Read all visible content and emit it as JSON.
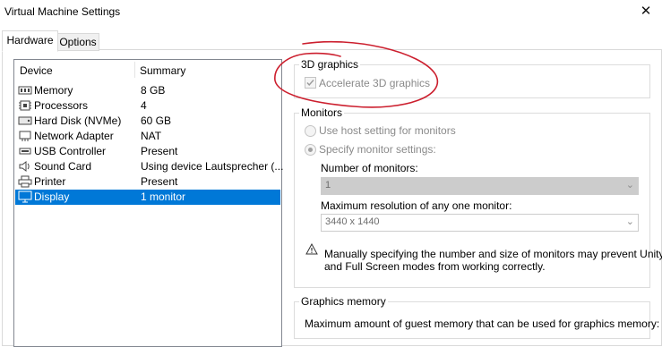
{
  "window": {
    "title": "Virtual Machine Settings",
    "close_glyph": "✕"
  },
  "tabs": [
    {
      "label": "Hardware",
      "active": true
    },
    {
      "label": "Options",
      "active": false
    }
  ],
  "device_list": {
    "columns": {
      "device": "Device",
      "summary": "Summary"
    },
    "rows": [
      {
        "icon": "memory-icon",
        "name": "Memory",
        "summary": "8 GB"
      },
      {
        "icon": "processor-icon",
        "name": "Processors",
        "summary": "4"
      },
      {
        "icon": "hard-disk-icon",
        "name": "Hard Disk (NVMe)",
        "summary": "60 GB"
      },
      {
        "icon": "network-adapter-icon",
        "name": "Network Adapter",
        "summary": "NAT"
      },
      {
        "icon": "usb-controller-icon",
        "name": "USB Controller",
        "summary": "Present"
      },
      {
        "icon": "sound-card-icon",
        "name": "Sound Card",
        "summary": "Using device Lautsprecher (..."
      },
      {
        "icon": "printer-icon",
        "name": "Printer",
        "summary": "Present"
      },
      {
        "icon": "display-icon",
        "name": "Display",
        "summary": "1 monitor",
        "selected": true
      }
    ]
  },
  "graphics_3d": {
    "label": "3D graphics",
    "accelerate_label": "Accelerate 3D graphics",
    "accelerate_checked": true
  },
  "monitors": {
    "label": "Monitors",
    "use_host_label": "Use host setting for monitors",
    "specify_label": "Specify monitor settings:",
    "specify_selected": true,
    "number_label": "Number of monitors:",
    "number_value": "1",
    "resolution_label": "Maximum resolution of any one monitor:",
    "resolution_value": "3440 x 1440",
    "warning_line1": "Manually specifying the number and size of monitors may prevent Unity",
    "warning_line2": "and Full Screen modes from working correctly."
  },
  "graphics_memory": {
    "label": "Graphics memory",
    "description": "Maximum amount of guest memory that can be used for graphics memory:"
  },
  "colors": {
    "selection": "#0078d7",
    "annotation": "#cc1f2e"
  }
}
